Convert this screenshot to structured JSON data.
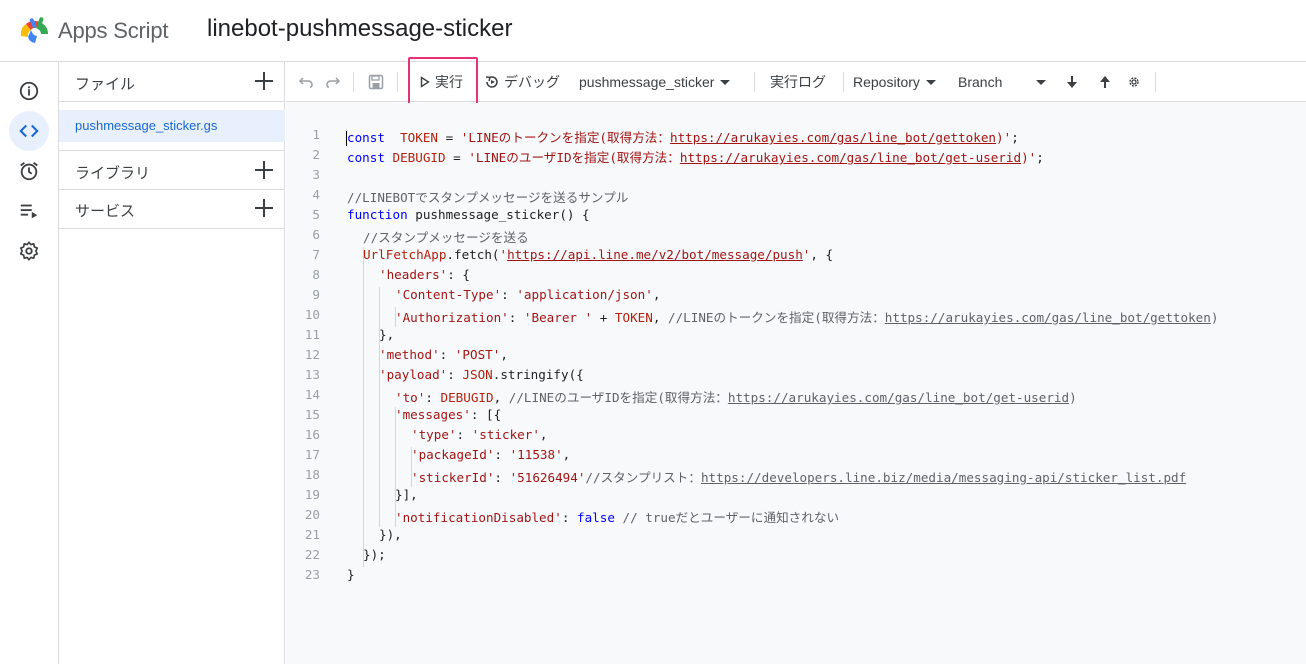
{
  "header": {
    "app_name": "Apps Script",
    "project_title": "linebot-pushmessage-sticker"
  },
  "rail": {
    "items": [
      {
        "icon": "info-icon"
      },
      {
        "icon": "code-icon",
        "active": true
      },
      {
        "icon": "alarm-clock-icon"
      },
      {
        "icon": "executions-icon"
      },
      {
        "icon": "gear-icon"
      }
    ]
  },
  "files_panel": {
    "files_label": "ファイル",
    "file_name": "pushmessage_sticker.gs",
    "libraries_label": "ライブラリ",
    "services_label": "サービス"
  },
  "toolbar": {
    "run_label": "実行",
    "debug_label": "デバッグ",
    "function_name": "pushmessage_sticker",
    "log_label": "実行ログ",
    "repository_label": "Repository",
    "branch_label": "Branch"
  },
  "editor": {
    "lines": [
      {
        "n": "1",
        "indent": 0,
        "segs": [
          [
            "kw",
            "const"
          ],
          [
            "",
            "  "
          ],
          [
            "var",
            "TOKEN"
          ],
          [
            "",
            " = "
          ],
          [
            "str",
            "'LINEのトークンを指定(取得方法："
          ],
          [
            "strurl",
            "https://arukayies.com/gas/line_bot/gettoken"
          ],
          [
            "str",
            ")'"
          ],
          [
            "",
            ";"
          ]
        ]
      },
      {
        "n": "2",
        "indent": 0,
        "segs": [
          [
            "kw",
            "const"
          ],
          [
            "",
            " "
          ],
          [
            "var",
            "DEBUGID"
          ],
          [
            "",
            " = "
          ],
          [
            "str",
            "'LINEのユーザIDを指定(取得方法："
          ],
          [
            "strurl",
            "https://arukayies.com/gas/line_bot/get-userid"
          ],
          [
            "str",
            ")'"
          ],
          [
            "",
            ";"
          ]
        ]
      },
      {
        "n": "3",
        "indent": 0,
        "segs": []
      },
      {
        "n": "4",
        "indent": 0,
        "segs": [
          [
            "com",
            "//LINEBOTでスタンプメッセージを送るサンプル"
          ]
        ]
      },
      {
        "n": "5",
        "indent": 0,
        "segs": [
          [
            "kw",
            "function"
          ],
          [
            "",
            " pushmessage_sticker() {"
          ]
        ]
      },
      {
        "n": "6",
        "indent": 1,
        "segs": [
          [
            "com",
            "//スタンプメッセージを送る"
          ]
        ]
      },
      {
        "n": "7",
        "indent": 1,
        "segs": [
          [
            "var",
            "UrlFetchApp"
          ],
          [
            "",
            ".fetch("
          ],
          [
            "str",
            "'"
          ],
          [
            "strurl",
            "https://api.line.me/v2/bot/message/push"
          ],
          [
            "str",
            "'"
          ],
          [
            "",
            ", {"
          ]
        ]
      },
      {
        "n": "8",
        "indent": 2,
        "segs": [
          [
            "str",
            "'headers'"
          ],
          [
            "",
            ": {"
          ]
        ]
      },
      {
        "n": "9",
        "indent": 3,
        "segs": [
          [
            "str",
            "'Content-Type'"
          ],
          [
            "",
            ": "
          ],
          [
            "str",
            "'application/json'"
          ],
          [
            "",
            ","
          ]
        ]
      },
      {
        "n": "10",
        "indent": 3,
        "segs": [
          [
            "str",
            "'Authorization'"
          ],
          [
            "",
            ": "
          ],
          [
            "str",
            "'Bearer '"
          ],
          [
            "",
            " + "
          ],
          [
            "var",
            "TOKEN"
          ],
          [
            "",
            ", "
          ],
          [
            "com",
            "//LINEのトークンを指定(取得方法："
          ],
          [
            "comurl",
            "https://arukayies.com/gas/line_bot/gettoken"
          ],
          [
            "com",
            ")"
          ]
        ]
      },
      {
        "n": "11",
        "indent": 2,
        "segs": [
          [
            "",
            "},"
          ]
        ]
      },
      {
        "n": "12",
        "indent": 2,
        "segs": [
          [
            "str",
            "'method'"
          ],
          [
            "",
            ": "
          ],
          [
            "str",
            "'POST'"
          ],
          [
            "",
            ","
          ]
        ]
      },
      {
        "n": "13",
        "indent": 2,
        "segs": [
          [
            "str",
            "'payload'"
          ],
          [
            "",
            ": "
          ],
          [
            "var",
            "JSON"
          ],
          [
            "",
            ".stringify({"
          ]
        ]
      },
      {
        "n": "14",
        "indent": 3,
        "segs": [
          [
            "str",
            "'to'"
          ],
          [
            "",
            ": "
          ],
          [
            "var",
            "DEBUGID"
          ],
          [
            "",
            ", "
          ],
          [
            "com",
            "//LINEのユーザIDを指定(取得方法："
          ],
          [
            "comurl",
            "https://arukayies.com/gas/line_bot/get-userid"
          ],
          [
            "com",
            ")"
          ]
        ]
      },
      {
        "n": "15",
        "indent": 3,
        "segs": [
          [
            "str",
            "'messages'"
          ],
          [
            "",
            ": [{"
          ]
        ]
      },
      {
        "n": "16",
        "indent": 4,
        "segs": [
          [
            "str",
            "'type'"
          ],
          [
            "",
            ": "
          ],
          [
            "str",
            "'sticker'"
          ],
          [
            "",
            ","
          ]
        ]
      },
      {
        "n": "17",
        "indent": 4,
        "segs": [
          [
            "str",
            "'packageId'"
          ],
          [
            "",
            ": "
          ],
          [
            "str",
            "'11538'"
          ],
          [
            "",
            ","
          ]
        ]
      },
      {
        "n": "18",
        "indent": 4,
        "segs": [
          [
            "str",
            "'stickerId'"
          ],
          [
            "",
            ": "
          ],
          [
            "str",
            "'51626494'"
          ],
          [
            "com",
            "//スタンプリスト："
          ],
          [
            "comurl",
            "https://developers.line.biz/media/messaging-api/sticker_list.pdf"
          ]
        ]
      },
      {
        "n": "19",
        "indent": 3,
        "segs": [
          [
            "",
            "}],"
          ]
        ]
      },
      {
        "n": "20",
        "indent": 3,
        "segs": [
          [
            "str",
            "'notificationDisabled'"
          ],
          [
            "",
            ": "
          ],
          [
            "kw",
            "false"
          ],
          [
            "",
            " "
          ],
          [
            "com",
            "// trueだとユーザーに通知されない"
          ]
        ]
      },
      {
        "n": "21",
        "indent": 2,
        "segs": [
          [
            "",
            "}),"
          ]
        ]
      },
      {
        "n": "22",
        "indent": 1,
        "segs": [
          [
            "",
            "});"
          ]
        ]
      },
      {
        "n": "23",
        "indent": 0,
        "segs": [
          [
            "",
            "}"
          ]
        ]
      }
    ]
  }
}
